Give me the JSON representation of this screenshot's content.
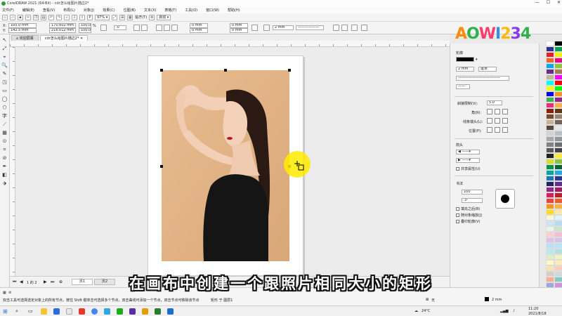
{
  "window": {
    "title": "CorelDRAW 2021 (64-Bit) - cdr怎么给图片描边2*",
    "controls": [
      "—",
      "☐",
      "✕"
    ]
  },
  "menu": [
    "文件(F)",
    "编辑(E)",
    "查看(V)",
    "布局(L)",
    "对象(J)",
    "效果(C)",
    "位图(B)",
    "文本(X)",
    "表格(T)",
    "工具(O)",
    "窗口(W)",
    "帮助(H)"
  ],
  "toolbar": {
    "zoom": "97%",
    "snap_label": "贴齐(T)",
    "launch_label": "启动"
  },
  "propbar": {
    "x": "105.0 mm",
    "y": "142.5 mm",
    "w": "170.602 mm",
    "h": "216.012 mm",
    "sx": "100.0",
    "sy": "100.0",
    "pct": "%",
    "angle": ".0",
    "unit1": "0 mm",
    "unit2": "0 mm",
    "outline": "2 mm"
  },
  "logo": {
    "text": "AOWI234",
    "colors": [
      "#ff8a00",
      "#2fb24a",
      "#ff3b6b",
      "#2f8ee8",
      "#ffb800",
      "#8a3be8",
      "#2fb24a"
    ]
  },
  "tabs": {
    "welcome": "欢迎屏幕",
    "doc": "cdr怎么给图片描边2*"
  },
  "tools": [
    "↖",
    "⤢",
    "⌖",
    "🔍",
    "✎",
    "◳",
    "▭",
    "◯",
    "⬡",
    "字",
    "⟋",
    "▦",
    "⊙",
    "⌗",
    "⊘",
    "✒",
    "◧",
    "⬗"
  ],
  "panel": {
    "header": "轮廓",
    "width_value": "2 mm",
    "unit": "毫米",
    "miter_label": "斜接限制(V):",
    "miter_value": "5.0",
    "corner_label": "角(R):",
    "cap_label": "线条端头(L):",
    "position_label": "位置(P):",
    "arrows_label": "箭头",
    "share_label": "共享属性(U)",
    "calligraphy_label": "书法",
    "stretch_value": "100",
    "angle_value": ".0",
    "fill_behind_label": "填充之后(B)",
    "scale_label": "随对象缩放(J)",
    "overprint_label": "叠印轮廓(V)"
  },
  "pagenav": {
    "pages": "1 的 2",
    "page1": "页1",
    "page2": "页2"
  },
  "status": {
    "hint": "双击工具可选择选定对象上的所有节点，按住 Shift 键单击可选择多个节点，双击曲线可添加一个节点，双击节点可移除该节点",
    "object": "矩形 于 图层1",
    "fill": "无"
  },
  "subtitle": "在画布中创建一个跟照片相同大小的矩形",
  "taskbar": {
    "weather": "24°C",
    "time": "11:20",
    "date": "2021/8/18"
  },
  "palette": [
    "#ffffff",
    "#000000",
    "#2e3192",
    "#00a651",
    "#ed1c24",
    "#fff200",
    "#f26522",
    "#ec008c",
    "#00aeef",
    "#8dc63f",
    "#662d91",
    "#a67c52",
    "#c2b59b",
    "#ff00ff",
    "#00ffff",
    "#ff0000",
    "#ffff00",
    "#00ff00",
    "#0000ff",
    "#f7941d",
    "#39b54a",
    "#92278f",
    "#ee2a7b",
    "#fbb040",
    "#8a1f11",
    "#603913",
    "#754c24",
    "#998675",
    "#c7b299",
    "#736357",
    "#534741",
    "#e6e7e8",
    "#d1d3d4",
    "#bcbec0",
    "#a7a9ac",
    "#939598",
    "#808285",
    "#6d6e71",
    "#58595b",
    "#414042",
    "#231f20",
    "#f9ed32",
    "#d7df23",
    "#8bc53f",
    "#009444",
    "#006838",
    "#00a79d",
    "#27aae1",
    "#1c75bc",
    "#2b3990",
    "#262262",
    "#662d91",
    "#92278f",
    "#9e1f63",
    "#da1c5c",
    "#be1e2d",
    "#ef4136",
    "#f15a29",
    "#f7941d",
    "#fbb040",
    "#ffde17",
    "#ffe9a5",
    "#fff5d7",
    "#e0f3fc",
    "#c9e8f7",
    "#b5dcf0",
    "#e8f5e9",
    "#c8e6c9",
    "#ffcdd2",
    "#f8bbd0",
    "#e1bee7",
    "#d1c4e9",
    "#bbdefb",
    "#b3e5fc",
    "#b2ebf2",
    "#b2dfdb",
    "#dcedc8",
    "#f0f4c3",
    "#fff9c4",
    "#ffecb3",
    "#ffe0b2",
    "#ffccbc",
    "#d7ccc8",
    "#cfd8dc",
    "#ffab91",
    "#80cbc4",
    "#9fa8da",
    "#ce93d8",
    "#ef9a9a",
    "#a5d6a7",
    "#fff59d",
    "#ffcc80",
    "#bcaaa4",
    "#b0bec5",
    "#ff8a80",
    "#82b1ff",
    "#ccff90"
  ]
}
